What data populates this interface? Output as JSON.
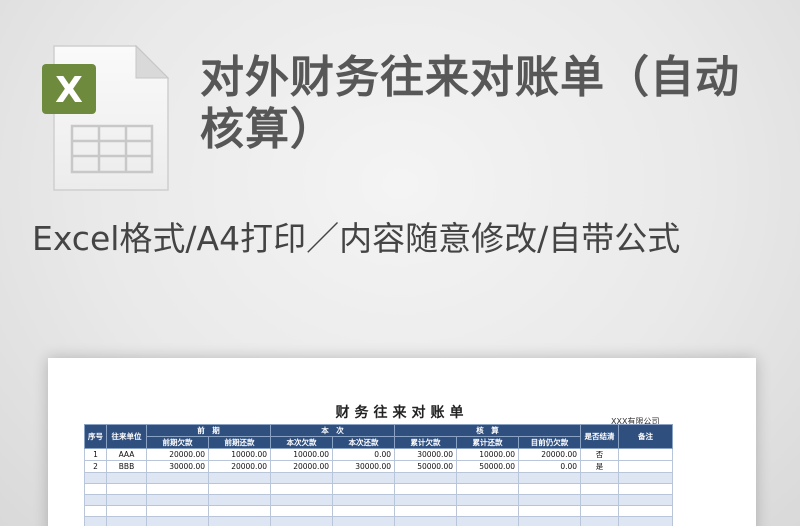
{
  "title": "对外财务往来对账单（自动核算）",
  "subtitle": "Excel格式/A4打印／内容随意修改/自带公式",
  "icon": {
    "name": "excel-file-icon",
    "badge_letter": "X",
    "accent": "#6e8b3d"
  },
  "sheet": {
    "title": "财务往来对账单",
    "company": "XXX有限公司",
    "header": {
      "seq": "序号",
      "unit": "往来单位",
      "prior_group": "前　期",
      "prior_owed": "前期欠款",
      "prior_paid": "前期还款",
      "current_group": "本　次",
      "current_owed": "本次欠款",
      "current_paid": "本次还款",
      "check_group": "核　算",
      "cum_owed": "累计欠款",
      "cum_paid": "累计还款",
      "still_owed": "目前仍欠款",
      "settled": "是否结清",
      "remark": "备注"
    },
    "rows": [
      {
        "seq": "1",
        "unit": "AAA",
        "prior_owed": "20000.00",
        "prior_paid": "10000.00",
        "current_owed": "10000.00",
        "current_paid": "0.00",
        "cum_owed": "30000.00",
        "cum_paid": "10000.00",
        "still_owed": "20000.00",
        "settled": "否",
        "remark": ""
      },
      {
        "seq": "2",
        "unit": "BBB",
        "prior_owed": "30000.00",
        "prior_paid": "20000.00",
        "current_owed": "20000.00",
        "current_paid": "30000.00",
        "cum_owed": "50000.00",
        "cum_paid": "50000.00",
        "still_owed": "0.00",
        "settled": "是",
        "remark": ""
      }
    ],
    "colors": {
      "header_bg": "#2f4f7f",
      "row_shade": "#dde6f2"
    }
  }
}
